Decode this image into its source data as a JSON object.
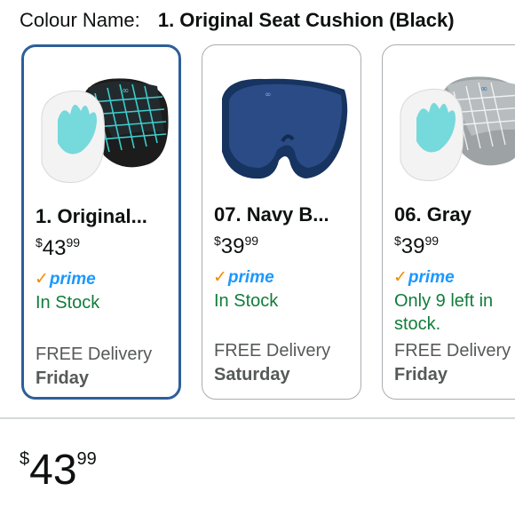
{
  "colour": {
    "label": "Colour Name:",
    "value": "1. Original Seat Cushion (Black)"
  },
  "cards": [
    {
      "title": "1. Original...",
      "price_symbol": "$",
      "price_whole": "43",
      "price_fraction": "99",
      "prime_label": "prime",
      "stock": "In Stock",
      "delivery_label": "FREE Delivery",
      "delivery_day": "Friday",
      "selected": true
    },
    {
      "title": "07. Navy B...",
      "price_symbol": "$",
      "price_whole": "39",
      "price_fraction": "99",
      "prime_label": "prime",
      "stock": "In Stock",
      "delivery_label": "FREE Delivery",
      "delivery_day": "Saturday",
      "selected": false
    },
    {
      "title": "06. Gray",
      "price_symbol": "$",
      "price_whole": "39",
      "price_fraction": "99",
      "prime_label": "prime",
      "stock": "Only 9 left in stock.",
      "delivery_label": "FREE Delivery",
      "delivery_day": "Friday",
      "selected": false
    }
  ],
  "price": {
    "symbol": "$",
    "whole": "43",
    "fraction": "99"
  },
  "colors": {
    "selected_border": "#2d5f99",
    "prime_blue": "#1a98ff",
    "prime_check": "#f08c00",
    "stock_green": "#117d3b",
    "muted_text": "#565959"
  }
}
